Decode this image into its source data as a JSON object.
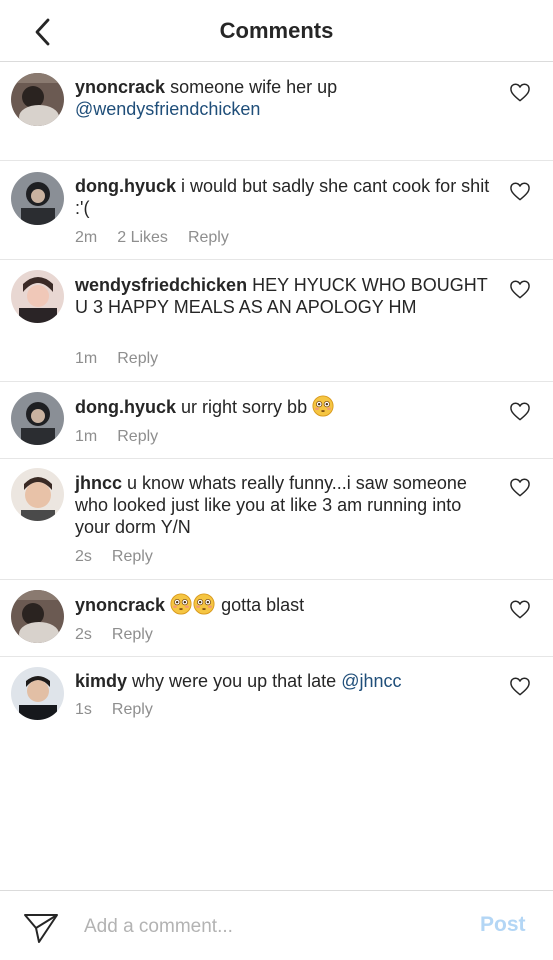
{
  "header": {
    "title": "Comments",
    "back_icon": "chevron-left-icon"
  },
  "comments": [
    {
      "user": "ynoncrack",
      "text": "someone wife her up",
      "mention": "@wendysfriendchicken"
    },
    {
      "user": "dong.hyuck",
      "text": "i would but sadly she cant cook for shit :'(",
      "time": "2m",
      "likes": "2 Likes",
      "reply": "Reply"
    },
    {
      "user": "wendysfriedchicken",
      "text": "HEY HYUCK WHO BOUGHT U 3 HAPPY MEALS AS AN APOLOGY HM",
      "time": "1m",
      "reply": "Reply"
    },
    {
      "user": "dong.hyuck",
      "text": "ur right sorry bb",
      "emoji": "flushed-face-emoji",
      "time": "1m",
      "reply": "Reply"
    },
    {
      "user": "jhncc",
      "text": "u know whats really funny...i saw someone who looked just like you at like 3 am running into your dorm Y/N",
      "time": "2s",
      "reply": "Reply"
    },
    {
      "user": "ynoncrack",
      "text": "gotta blast",
      "emoji": "flushed-face-emoji",
      "time": "2s",
      "reply": "Reply"
    },
    {
      "user": "kimdy",
      "text": "why were you up that late",
      "mention": "@jhncc",
      "time": "1s",
      "reply": "Reply"
    }
  ],
  "footer": {
    "placeholder": "Add a comment...",
    "post_label": "Post",
    "send_icon": "paper-plane-icon"
  },
  "colors": {
    "mention": "#1f4e79",
    "post_disabled": "#b3d6f5",
    "meta": "#8e8e8e"
  }
}
